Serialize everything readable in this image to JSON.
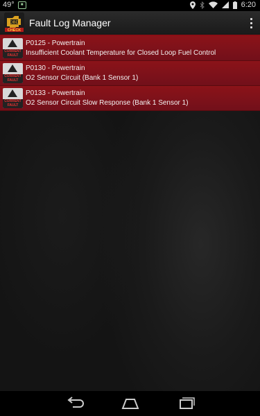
{
  "status_bar": {
    "temperature": "49°",
    "time": "6:20",
    "icons": [
      "notification-icon",
      "location-icon",
      "bluetooth-icon",
      "wifi-icon",
      "signal-icon",
      "battery-icon"
    ]
  },
  "action_bar": {
    "title": "Fault Log Manager",
    "app_icon_text_top": "OBD",
    "app_icon_text_bottom": "CHECK",
    "overflow_icon": "more-vert-icon"
  },
  "faults": [
    {
      "code_line": "P0125 - Powertrain",
      "description": "Insufficient Coolant Temperature for Closed Loop Fuel Control",
      "badge_line1": "CURRENT",
      "badge_line2": "FAULT"
    },
    {
      "code_line": "P0130 - Powertrain",
      "description": "O2 Sensor Circuit (Bank 1 Sensor 1)",
      "badge_line1": "CURRENT",
      "badge_line2": "FAULT"
    },
    {
      "code_line": "P0133 - Powertrain",
      "description": "O2 Sensor Circuit Slow Response (Bank 1 Sensor 1)",
      "badge_line1": "CURRENT",
      "badge_line2": "FAULT"
    }
  ],
  "nav_bar": {
    "icons": [
      "back-icon",
      "home-icon",
      "recent-apps-icon"
    ]
  },
  "colors": {
    "accent": "#8b0e14",
    "row_background": "#7f111a",
    "action_bar": "#222222"
  }
}
